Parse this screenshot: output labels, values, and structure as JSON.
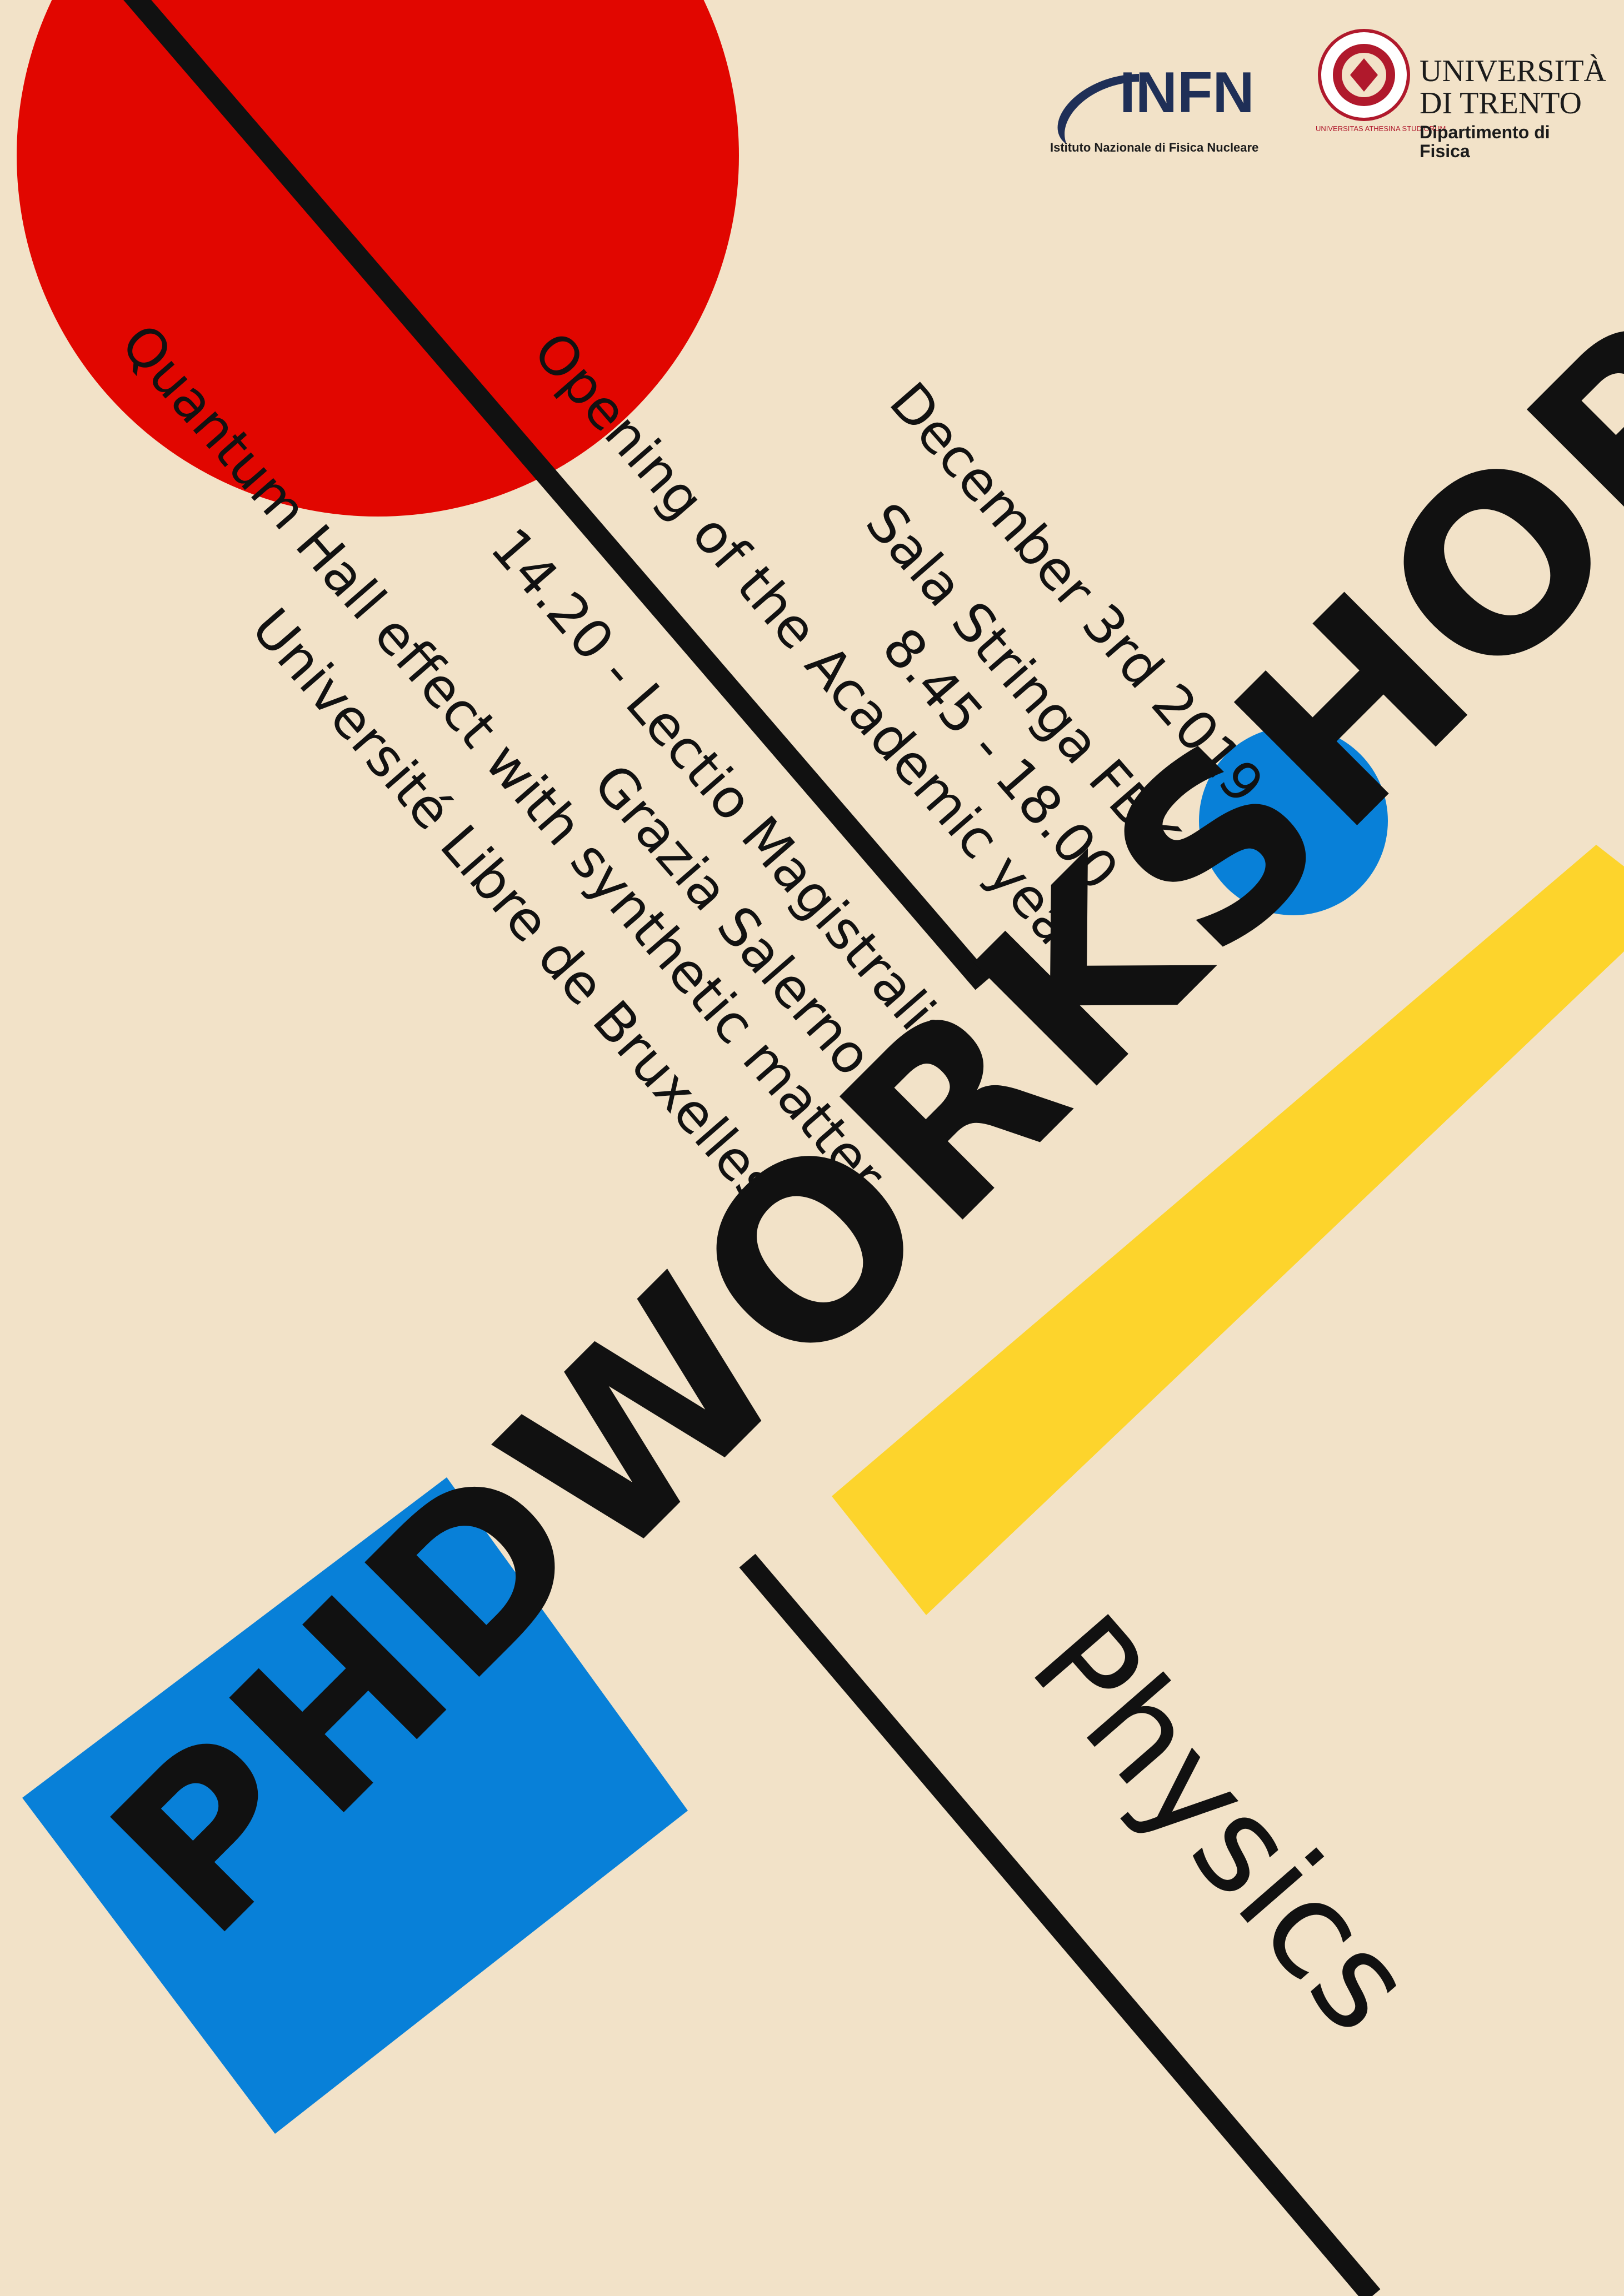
{
  "colors": {
    "background": "#f2e2c8",
    "red": "#e10600",
    "blue": "#0880d8",
    "yellow": "#fdd42c",
    "ink": "#111111",
    "infn_navy": "#1f2f57"
  },
  "logos": {
    "infn": {
      "short": "INFN",
      "full": "Istituto Nazionale di Fisica Nucleare"
    },
    "unitn": {
      "seal_text": "UNIVERSITAS ATHESINA STUDIORUM",
      "line1": "UNIVERSITÀ",
      "line2": "DI TRENTO",
      "dept1": "Dipartimento di",
      "dept2": "Fisica"
    }
  },
  "event": {
    "date": "December 3rd 2019",
    "venue": "Sala Stringa FBK",
    "time": "8.45 - 18.00",
    "opening": "Opening of the Academic year",
    "lectio": "14.20 - Lectio Magistralis",
    "speaker": "Grazia Salerno",
    "talk": "Quantum Hall effect with synthetic matter",
    "affiliation": "Université Libre de Bruxelles"
  },
  "title": {
    "phd": "PHD",
    "workshop": "WORKSHOP",
    "subject": "Physics"
  }
}
